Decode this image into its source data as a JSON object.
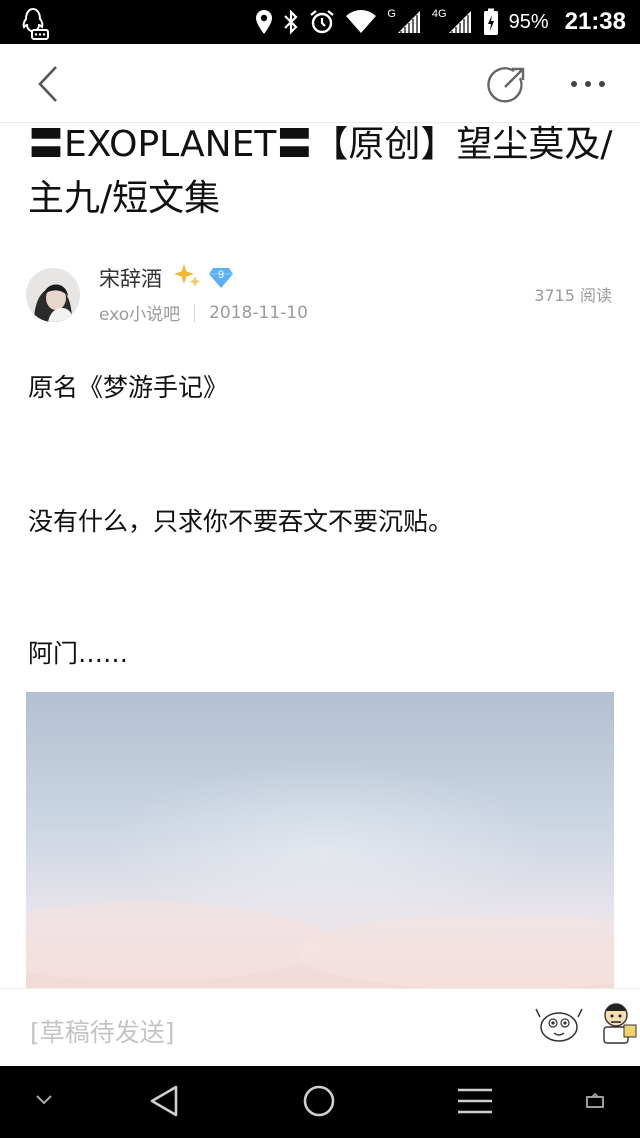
{
  "status_bar": {
    "network_top": "G",
    "network_second": "4G",
    "battery_percent": "95%",
    "time": "21:38",
    "icons": [
      "qq-notification-icon",
      "location-icon",
      "bluetooth-icon",
      "alarm-icon",
      "wifi-icon",
      "signal-icon",
      "signal-icon",
      "battery-icon"
    ]
  },
  "topbar": {
    "icons": [
      "back-arrow-icon",
      "share-icon",
      "more-icon"
    ]
  },
  "post": {
    "title": "〓EXOPLANET〓【原创】望尘莫及/主九/短文集",
    "author": {
      "name": "宋辞酒",
      "level": "9",
      "forum": "exo小说吧",
      "date": "2018-11-10"
    },
    "reads": "3715 阅读",
    "paragraphs": [
      "原名《梦游手记》",
      "没有什么，只求你不要吞文不要沉贴。",
      "阿门……"
    ]
  },
  "input_bar": {
    "draft_text": "[草稿待发送]",
    "icons": [
      "emoji-sticker-icon",
      "emoji-sticker-icon"
    ]
  },
  "nav_bar": {
    "icons": [
      "chevron-down-icon",
      "back-triangle-icon",
      "home-circle-icon",
      "menu-icon",
      "window-icon"
    ]
  },
  "colors": {
    "status_bg": "#000000",
    "text_primary": "#111111",
    "text_secondary": "#9a9a9a",
    "badge_blue": "#4aa0f0",
    "badge_gold": "#f2b632"
  }
}
